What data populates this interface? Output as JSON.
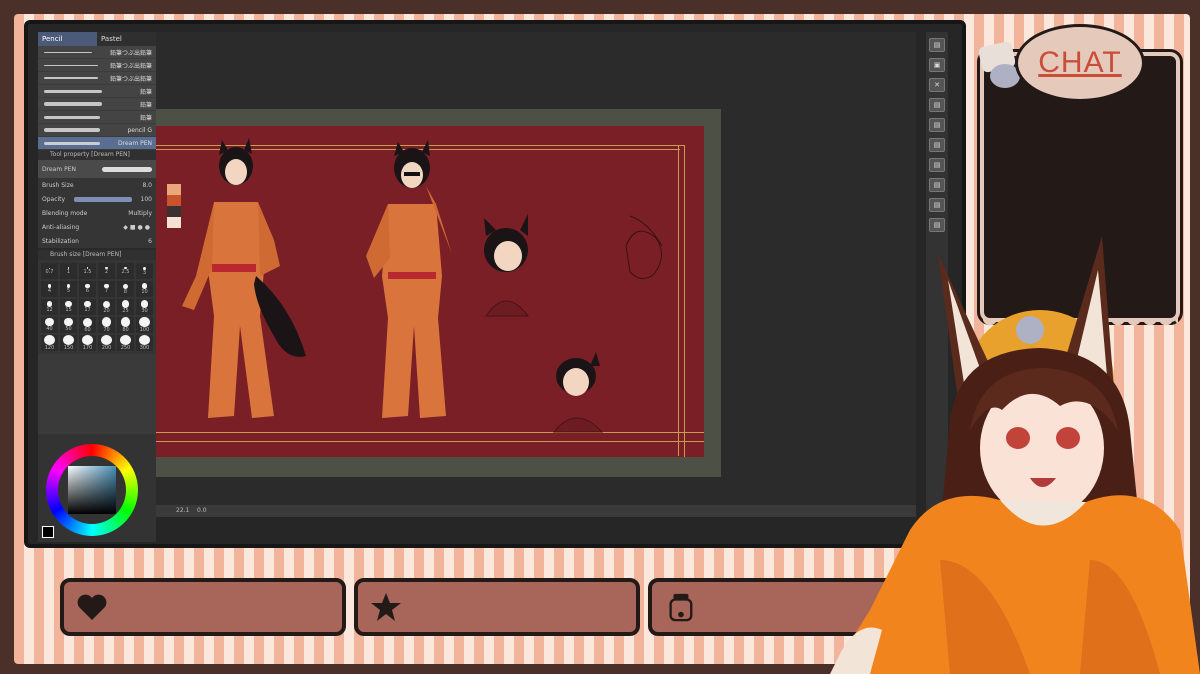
{
  "left_panel": {
    "tabs": [
      "Pencil",
      "Pastel"
    ],
    "brushes": [
      {
        "name": "鉛筆つぶ出鉛筆",
        "selected": false
      },
      {
        "name": "鉛筆つぶ出鉛筆",
        "selected": false
      },
      {
        "name": "鉛筆つぶ出鉛筆",
        "selected": false
      },
      {
        "name": "鉛筆",
        "selected": false
      },
      {
        "name": "鉛筆",
        "selected": false
      },
      {
        "name": "鉛筆",
        "selected": false
      },
      {
        "name": "pencil G",
        "selected": false
      },
      {
        "name": "Dream PEN",
        "selected": true
      }
    ],
    "tool_property": {
      "title": "Tool property [Dream PEN]",
      "brush_name": "Dream PEN",
      "brush_size_label": "Brush Size",
      "brush_size_value": "8.0",
      "opacity_label": "Opacity",
      "opacity_value": "100",
      "blending_label": "Blending mode",
      "blending_value": "Multiply",
      "antialias_label": "Anti-aliasing",
      "stabilization_label": "Stabilization",
      "stabilization_value": "6"
    },
    "brush_size_panel": {
      "title": "Brush size [Dream PEN]",
      "sizes": [
        "0.7",
        "1",
        "1.5",
        "2",
        "2.5",
        "3",
        "4",
        "5",
        "6",
        "7",
        "8",
        "10",
        "12",
        "15",
        "17",
        "20",
        "25",
        "30",
        "40",
        "50",
        "60",
        "70",
        "80",
        "100",
        "120",
        "150",
        "170",
        "200",
        "250",
        "300"
      ]
    }
  },
  "canvas": {
    "palette_colors": [
      "#e9a77b",
      "#c9542c",
      "#3b3131",
      "#7a1f26",
      "#f4e3d4"
    ],
    "status_text": "22.1",
    "zoom": "0.0"
  },
  "right_toolbar": {
    "buttons": [
      "▤",
      "▣",
      "✕",
      "▤",
      "▤",
      "▤",
      "▤",
      "▤",
      "▤",
      "▤"
    ]
  },
  "chat": {
    "title": "CHAT"
  },
  "bottom_bars": [
    {
      "icon": "heart-icon"
    },
    {
      "icon": "star-icon"
    },
    {
      "icon": "tip-jar-icon"
    }
  ],
  "colors": {
    "accent": "#c94e3a",
    "stripe_light": "#fbe7dc",
    "stripe_dark": "#f2b49a",
    "frame_dark": "#231a18",
    "bar_fill": "#a76659",
    "artboard": "#7a1f26"
  }
}
